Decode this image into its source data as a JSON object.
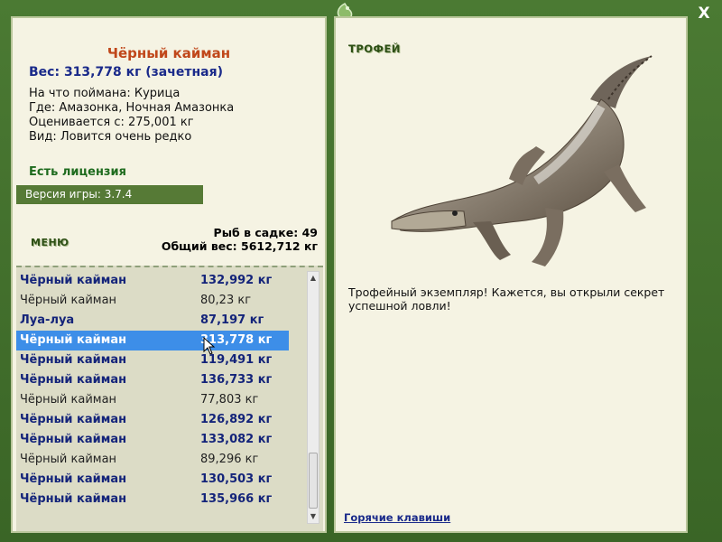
{
  "window": {
    "close_label": "X"
  },
  "fish": {
    "name": "Чёрный кайман",
    "weight": "Вес: 313,778 кг (зачетная)",
    "caught_on": "На что поймана: Курица",
    "location": "Где: Амазонка, Ночная Амазонка",
    "rated_from": "Оценивается с: 275,001 кг",
    "rarity": "Вид: Ловится очень редко"
  },
  "license": "Есть лицензия",
  "version": "Версия игры: 3.7.4",
  "menu_label": "МЕНЮ",
  "stats": {
    "fish_count": "Рыб в садке: 49",
    "total_weight": "Общий вес: 5612,712 кг"
  },
  "catch_list": [
    {
      "name": "Чёрный кайман",
      "weight": "132,992 кг",
      "style": "bold"
    },
    {
      "name": "Чёрный кайман",
      "weight": "80,23 кг",
      "style": "normal"
    },
    {
      "name": "Луа-луа",
      "weight": "87,197 кг",
      "style": "bold"
    },
    {
      "name": "Чёрный кайман",
      "weight": "313,778 кг",
      "style": "selected"
    },
    {
      "name": "Чёрный кайман",
      "weight": "119,491 кг",
      "style": "bold"
    },
    {
      "name": "Чёрный кайман",
      "weight": "136,733 кг",
      "style": "bold"
    },
    {
      "name": "Чёрный кайман",
      "weight": "77,803 кг",
      "style": "normal"
    },
    {
      "name": "Чёрный кайман",
      "weight": "126,892 кг",
      "style": "bold"
    },
    {
      "name": "Чёрный кайман",
      "weight": "133,082 кг",
      "style": "bold"
    },
    {
      "name": "Чёрный кайман",
      "weight": "89,296 кг",
      "style": "normal"
    },
    {
      "name": "Чёрный кайман",
      "weight": "130,503 кг",
      "style": "bold"
    },
    {
      "name": "Чёрный кайман",
      "weight": "135,966 кг",
      "style": "bold"
    }
  ],
  "trophy": {
    "label": "ТРОФЕЙ",
    "text": "Трофейный экземпляр! Кажется, вы открыли секрет успешной ловли!",
    "image_icon": "black-caiman-image"
  },
  "hotkeys_link": "Горячие клавиши",
  "colors": {
    "accent_green": "#567a36",
    "selected_row": "#3d8ee8",
    "title_orange": "#c0471a",
    "bold_blue": "#14247a"
  }
}
